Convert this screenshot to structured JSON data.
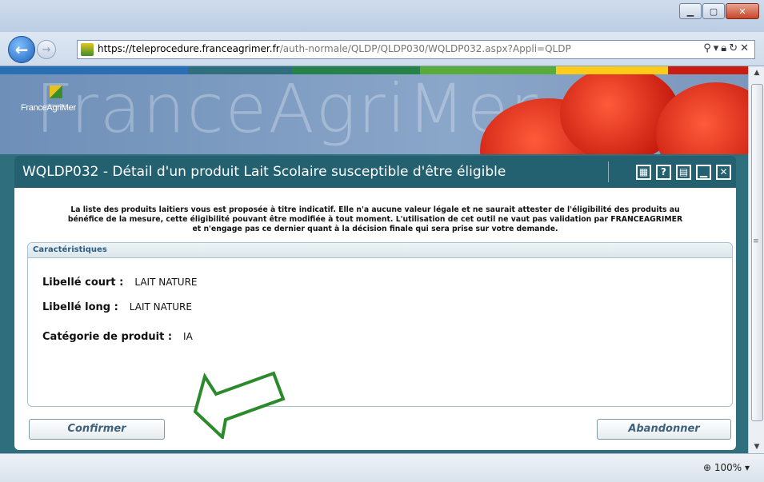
{
  "browser": {
    "url_host": "https://teleprocedure.franceagrimer.fr",
    "url_path": "/auth-normale/QLDP/QLDP030/WQLDP032.aspx?Appli=QLDP",
    "zoom": "100%"
  },
  "banner": {
    "logo_text": "FranceAgriMer",
    "big_name": "FranceAgriMer",
    "strip_colors": [
      "#2a6fb3",
      "#2f6e7c",
      "#27824a",
      "#5aac3a",
      "#ffcc1a",
      "#c81d10"
    ]
  },
  "page": {
    "title": "WQLDP032 - Détail d'un produit Lait Scolaire susceptible d'être éligible"
  },
  "tools": [
    {
      "name": "calculator-icon",
      "glyph": "▦"
    },
    {
      "name": "help-icon",
      "glyph": "?"
    },
    {
      "name": "print-icon",
      "glyph": "▤"
    },
    {
      "name": "minimize-icon",
      "glyph": "▁"
    },
    {
      "name": "close-icon",
      "glyph": "✕"
    }
  ],
  "disclaimer": {
    "line1": "La liste des produits laitiers vous est proposée à titre indicatif. Elle n'a aucune valeur légale et ne saurait attester de l'éligibilité des produits au",
    "line2": "bénéfice de la mesure, cette éligibilité pouvant être modifiée à tout moment. L'utilisation de cet outil ne vaut pas validation par FRANCEAGRIMER",
    "line3": "et n'engage pas ce dernier quant à la décision finale qui sera prise sur votre demande."
  },
  "characteristics": {
    "legend": "Caractéristiques",
    "short_label": "Libellé court :",
    "short_value": "LAIT NATURE",
    "long_label": "Libellé long :",
    "long_value": "LAIT NATURE",
    "category_label": "Catégorie de produit :",
    "category_value": "IA"
  },
  "actions": {
    "confirm": "Confirmer",
    "cancel": "Abandonner"
  }
}
